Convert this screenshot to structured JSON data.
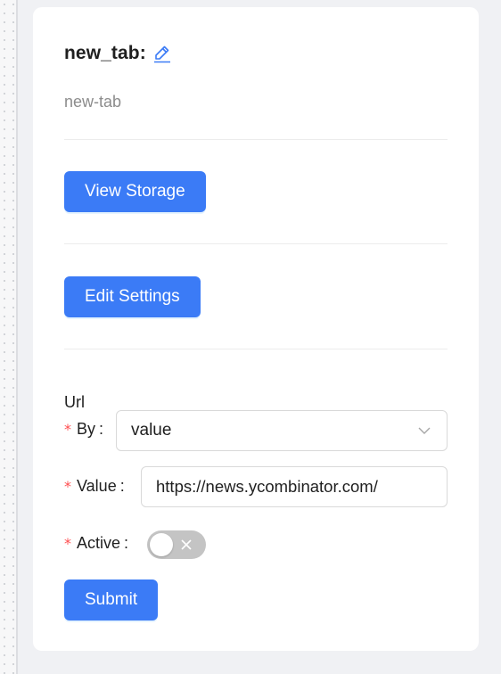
{
  "node": {
    "title": "new_tab:",
    "subtitle": "new-tab"
  },
  "actions": {
    "view_storage": "View Storage",
    "edit_settings": "Edit Settings"
  },
  "form": {
    "section_label": "Url",
    "required_mark": "*",
    "colon": ":",
    "by_label": "By",
    "by_value": "value",
    "value_label": "Value",
    "value_input": "https://news.ycombinator.com/",
    "active_label": "Active",
    "active_on": false,
    "submit": "Submit"
  },
  "colors": {
    "primary": "#3b7bf6",
    "required": "#ff4d4f",
    "toggle_off": "#c4c4c4"
  },
  "icons": {
    "edit": "pencil-icon",
    "dropdown": "chevron-down-icon",
    "toggle_off": "close-icon"
  }
}
